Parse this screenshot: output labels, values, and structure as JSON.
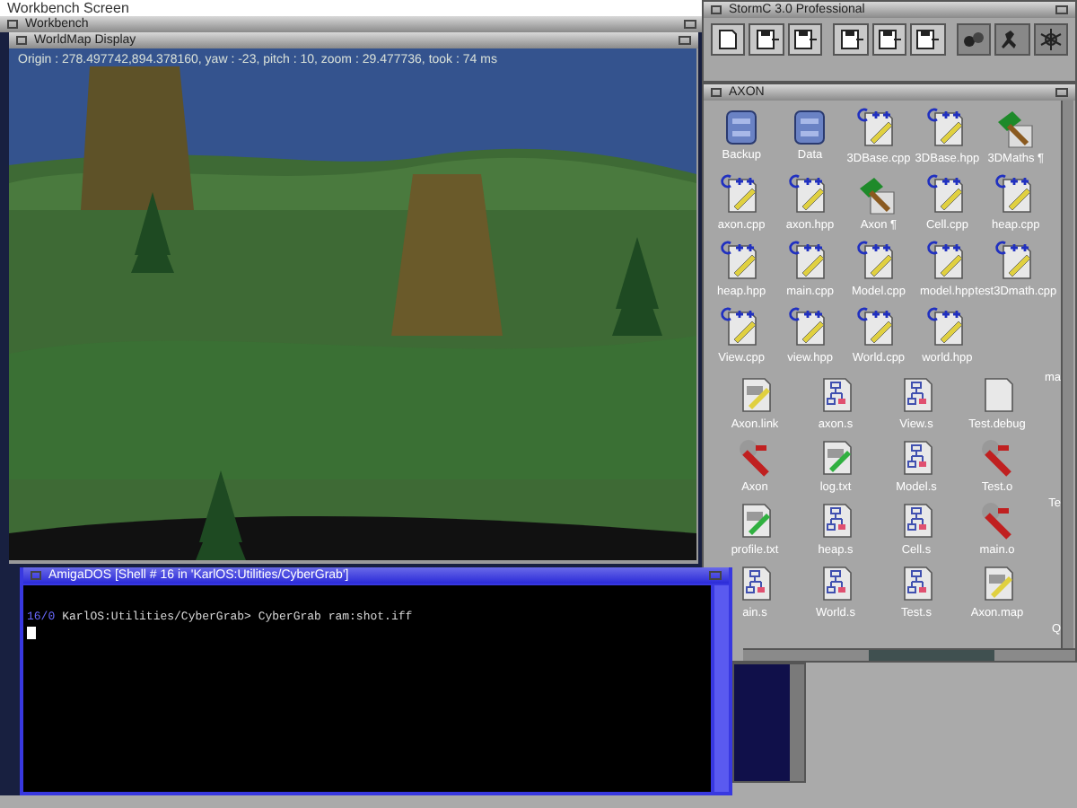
{
  "screen": {
    "title": "Workbench Screen"
  },
  "workbench_window": {
    "title": "Workbench"
  },
  "worldmap": {
    "title": "WorldMap Display",
    "status": "Origin : 278.497742,894.378160, yaw : -23, pitch : 10, zoom : 29.477736, took : 74 ms"
  },
  "stormc": {
    "title": "StormC 3.0 Professional"
  },
  "axon": {
    "title": "AXON",
    "sections": [
      {
        "icons": [
          {
            "label": "Backup",
            "kind": "drawer"
          },
          {
            "label": "Data",
            "kind": "drawer"
          },
          {
            "label": "3DBase.cpp",
            "kind": "cpp"
          },
          {
            "label": "3DBase.hpp",
            "kind": "cpp"
          },
          {
            "label": "3DMaths ¶",
            "kind": "project"
          },
          {
            "label": "axon.cpp",
            "kind": "cpp"
          },
          {
            "label": "axon.hpp",
            "kind": "cpp"
          },
          {
            "label": "Axon ¶",
            "kind": "project"
          },
          {
            "label": "Cell.cpp",
            "kind": "cpp"
          },
          {
            "label": "heap.cpp",
            "kind": "cpp"
          },
          {
            "label": "heap.hpp",
            "kind": "cpp"
          },
          {
            "label": "main.cpp",
            "kind": "cpp"
          },
          {
            "label": "Model.cpp",
            "kind": "cpp"
          },
          {
            "label": "model.hpp",
            "kind": "cpp"
          },
          {
            "label": "test3Dmath.cpp",
            "kind": "cpp"
          },
          {
            "label": "View.cpp",
            "kind": "cpp"
          },
          {
            "label": "view.hpp",
            "kind": "cpp"
          },
          {
            "label": "World.cpp",
            "kind": "cpp"
          },
          {
            "label": "world.hpp",
            "kind": "cpp"
          }
        ]
      },
      {
        "icons": [
          {
            "label": "Axon.link",
            "kind": "doc"
          },
          {
            "label": "axon.s",
            "kind": "asm"
          },
          {
            "label": "View.s",
            "kind": "asm"
          },
          {
            "label": "Test.debug",
            "kind": "blank"
          },
          {
            "label": "Axon",
            "kind": "exe"
          },
          {
            "label": "log.txt",
            "kind": "text"
          },
          {
            "label": "Model.s",
            "kind": "asm"
          },
          {
            "label": "Test.o",
            "kind": "exe"
          },
          {
            "label": "profile.txt",
            "kind": "text"
          },
          {
            "label": "heap.s",
            "kind": "asm"
          },
          {
            "label": "Cell.s",
            "kind": "asm"
          },
          {
            "label": "main.o",
            "kind": "exe"
          },
          {
            "label": "ain.s",
            "kind": "asm"
          },
          {
            "label": "World.s",
            "kind": "asm"
          },
          {
            "label": "Test.s",
            "kind": "asm"
          },
          {
            "label": "Axon.map",
            "kind": "doc"
          }
        ]
      }
    ],
    "cut_labels": [
      "ma",
      "Te",
      "Q"
    ]
  },
  "shell": {
    "title": "AmigaDOS [Shell # 16 in 'KarlOS:Utilities/CyberGrab']",
    "prompt": "16/0",
    "command": "KarlOS:Utilities/CyberGrab> CyberGrab ram:shot.iff"
  }
}
